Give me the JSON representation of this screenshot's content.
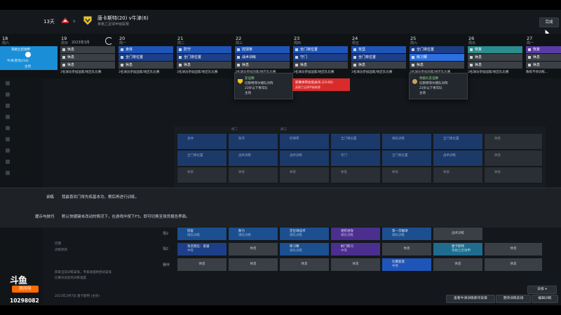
{
  "header": {
    "days_left": "13天",
    "vs": "v",
    "match_title": "唐卡斯特(20) v牛津(6)",
    "match_sub": "英格兰足球甲级联赛",
    "done": "完成"
  },
  "calendar": {
    "month": "2023年3月",
    "today": {
      "num": "18",
      "wd": "周六",
      "title": "英格兰足球甲",
      "sub": "牛津(客场)(18)",
      "sub2": "主场"
    },
    "days": [
      {
        "num": "19",
        "wd": "周日",
        "s1": "休息",
        "s2": "休息",
        "s3": "休息",
        "note": "3名球员参加国家/地区队比赛"
      },
      {
        "num": "20",
        "wd": "周一",
        "s1": "身体",
        "s2": "全门将位置",
        "s3": "休息",
        "note": "3名球员参加国家/地区队比赛"
      },
      {
        "num": "21",
        "wd": "周二",
        "s1": "防守",
        "s2": "全门将位置",
        "s3": "休息",
        "note": "3名球员参加国家/地区队比赛"
      },
      {
        "num": "22",
        "wd": "周三",
        "s1": "控球率",
        "s2": "战术训练",
        "s3": "休息",
        "note": "3名球员参加国家/地区队比赛"
      },
      {
        "num": "23",
        "wd": "周四",
        "s1": "全门将位置",
        "s2": "守门",
        "s3": "休息",
        "note": "3名球员参加国家/地区队比赛"
      },
      {
        "num": "24",
        "wd": "周五",
        "s1": "攻坚",
        "s2": "全门将位置",
        "s3": "休息",
        "note": "3名球员参加国家/地区队比赛"
      },
      {
        "num": "25",
        "wd": "周六",
        "s1": "全门将位置",
        "s2": "练习赛",
        "s3": "休息",
        "note": "3名球员参加国家/地区队比赛"
      },
      {
        "num": "26",
        "wd": "周日",
        "s1": "恢复",
        "s2": "休息",
        "s3": "休息",
        "note": "3名球员参加国家/地区队比赛"
      },
      {
        "num": "27",
        "wd": "周一",
        "s1": "恢复",
        "s2": "休息",
        "s3": "休息",
        "note": "教练不停训练..."
      }
    ]
  },
  "popups": {
    "p1": {
      "l1": "友谊赛",
      "l2": "切斯特菲尔德队对阵",
      "l3": "23岁以下青年队",
      "l4": "主场"
    },
    "red": {
      "l1": "新赛季转会窗关闭 (23:00)",
      "l2": "英格兰足球甲级联赛"
    },
    "p2": {
      "l1": "预备队友谊赛",
      "l2": "切斯特菲尔德队对阵",
      "l3": "23岁以下青年队",
      "l4": "主场"
    }
  },
  "grid": {
    "c1": "身体",
    "c2": "防守",
    "c3": "控球率",
    "c4": "全门将位置",
    "c5": "全门将位置",
    "c6": "战术训练",
    "c7": "守门",
    "c8": "休息",
    "lbl": "球队训练",
    "rest": "休息",
    "col2": "周二",
    "col3": "周三"
  },
  "info": {
    "l1_label": "训练",
    "l1_text": "我最喜欢门将先练基本功，赛后再进行训练。",
    "l2_label": "提示与技巧",
    "l2_text": "默认快捷键未改动的情况下，在游戏中按下F3，即可切换至球员报告界面。"
  },
  "lower": {
    "row1": "场2",
    "row2": "场2",
    "row3": "赛伴",
    "cells": {
      "a1": "恢复",
      "a1s": "球队训练",
      "a2": "耐力",
      "a2s": "球队训练",
      "a3": "定位球战术",
      "a3s": "球队训练",
      "a4": "组织进攻",
      "a4s": "球队训练",
      "a5": "第一次触球",
      "a5s": "球队训练",
      "a6": "战术训练",
      "b1": "攻坚跑位：紧逼",
      "b1s": "中等",
      "b2": "休息",
      "b3": "练习赛",
      "b3s": "球队训练",
      "b4": "射门练习",
      "b4s": "中等",
      "b5": "休息",
      "b6": "唐卡斯特",
      "b6s": "英格兰足球甲",
      "b7": "休息",
      "c1": "休息",
      "c2": "休息",
      "c3": "休息",
      "c4": "休息",
      "c5": "比赛复盘",
      "c5s": "中等",
      "c6": "休息",
      "c7": "休息"
    }
  },
  "bottom_left": {
    "t1": "近期",
    "t2": "训练原则",
    "t3": "获取当前训练安排，专家助理将尝试安排",
    "t4": "比赛日前后的训练强度",
    "t5": "2023年3月7日 唐卡斯特 (主场)"
  },
  "logo": {
    "a": "斗鱼",
    "b": "房间号",
    "c": "10298082"
  },
  "buttons": {
    "arrange": "安排",
    "b1": "查看牛津训练新作安排",
    "b2": "更改训练安排",
    "b3": "编辑训练"
  },
  "colors": {
    "accent": "#1a8fd8",
    "event_blue": "#1f55b8",
    "event_red": "#d92b2b",
    "event_teal": "#2a8d8f"
  }
}
